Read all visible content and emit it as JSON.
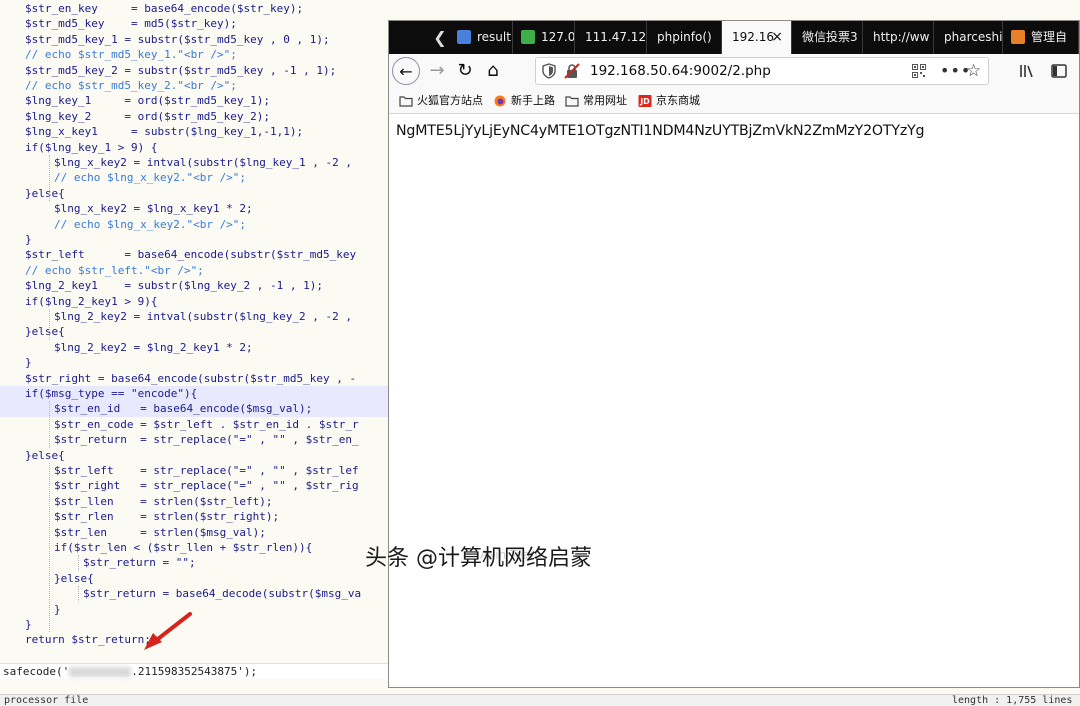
{
  "editor": {
    "code_lines": [
      {
        "indent": 1,
        "text": "$str_en_key     = base64_encode($str_key);"
      },
      {
        "indent": 1,
        "text": "$str_md5_key    = md5($str_key);"
      },
      {
        "indent": 1,
        "text": "$str_md5_key_1 = substr($str_md5_key , 0 , 1);"
      },
      {
        "indent": 1,
        "text": "// echo $str_md5_key_1.\"<br />\";",
        "comment": true
      },
      {
        "indent": 1,
        "text": "$str_md5_key_2 = substr($str_md5_key , -1 , 1);"
      },
      {
        "indent": 1,
        "text": "// echo $str_md5_key_2.\"<br />\";",
        "comment": true
      },
      {
        "indent": 1,
        "text": "$lng_key_1     = ord($str_md5_key_1);"
      },
      {
        "indent": 1,
        "text": "$lng_key_2     = ord($str_md5_key_2);"
      },
      {
        "indent": 1,
        "text": "$lng_x_key1     = substr($lng_key_1,-1,1);"
      },
      {
        "indent": 1,
        "text": "if($lng_key_1 > 9) {"
      },
      {
        "indent": 2,
        "text": "$lng_x_key2 = intval(substr($lng_key_1 , -2 ,"
      },
      {
        "indent": 2,
        "text": "// echo $lng_x_key2.\"<br />\";",
        "comment": true
      },
      {
        "indent": 1,
        "text": "}else{"
      },
      {
        "indent": 2,
        "text": "$lng_x_key2 = $lng_x_key1 * 2;"
      },
      {
        "indent": 2,
        "text": "// echo $lng_x_key2.\"<br />\";",
        "comment": true
      },
      {
        "indent": 1,
        "text": "}"
      },
      {
        "indent": 1,
        "text": "$str_left      = base64_encode(substr($str_md5_key"
      },
      {
        "indent": 1,
        "text": "// echo $str_left.\"<br />\";",
        "comment": true
      },
      {
        "indent": 1,
        "text": "$lng_2_key1    = substr($lng_key_2 , -1 , 1);"
      },
      {
        "indent": 1,
        "text": "if($lng_2_key1 > 9){"
      },
      {
        "indent": 2,
        "text": "$lng_2_key2 = intval(substr($lng_key_2 , -2 ,"
      },
      {
        "indent": 1,
        "text": "}else{"
      },
      {
        "indent": 2,
        "text": "$lng_2_key2 = $lng_2_key1 * 2;"
      },
      {
        "indent": 1,
        "text": "}"
      },
      {
        "indent": 1,
        "text": "$str_right = base64_encode(substr($str_md5_key , -"
      },
      {
        "indent": 1,
        "text": "if($msg_type == \"encode\"){",
        "highlight": true
      },
      {
        "indent": 2,
        "text": "$str_en_id   = base64_encode($msg_val);",
        "highlight": true
      },
      {
        "indent": 2,
        "text": "$str_en_code = $str_left . $str_en_id . $str_r"
      },
      {
        "indent": 2,
        "text": "$str_return  = str_replace(\"=\" , \"\" , $str_en_"
      },
      {
        "indent": 1,
        "text": "}else{"
      },
      {
        "indent": 2,
        "text": "$str_left    = str_replace(\"=\" , \"\" , $str_lef"
      },
      {
        "indent": 2,
        "text": "$str_right   = str_replace(\"=\" , \"\" , $str_rig"
      },
      {
        "indent": 2,
        "text": "$str_llen    = strlen($str_left);"
      },
      {
        "indent": 2,
        "text": "$str_rlen    = strlen($str_right);"
      },
      {
        "indent": 2,
        "text": "$str_len     = strlen($msg_val);"
      },
      {
        "indent": 2,
        "text": "if($str_len < ($str_llen + $str_rlen)){"
      },
      {
        "indent": 3,
        "text": "$str_return = \"\";"
      },
      {
        "indent": 2,
        "text": "}else{"
      },
      {
        "indent": 3,
        "text": "$str_return = base64_decode(substr($msg_va"
      },
      {
        "indent": 2,
        "text": "}"
      },
      {
        "indent": 1,
        "text": "}"
      },
      {
        "indent": 1,
        "text": "return $str_return;"
      }
    ],
    "last_line_prefix": "safecode('",
    "last_line_suffix": ".211598352543875');",
    "status_left": "processor file",
    "status_right": "length : 1,755    lines"
  },
  "browser": {
    "tabs": [
      {
        "label": "result",
        "icon": "paw-icon",
        "color": "#4a7fdc"
      },
      {
        "label": "127.0",
        "icon": "leaf-icon",
        "color": "#3fae49"
      },
      {
        "label": "111.47.12",
        "icon": "",
        "color": ""
      },
      {
        "label": "phpinfo()",
        "icon": "",
        "color": ""
      },
      {
        "label": "192.16",
        "icon": "",
        "color": "",
        "active": true
      },
      {
        "label": "微信投票3",
        "icon": "",
        "color": ""
      },
      {
        "label": "http://ww",
        "icon": "",
        "color": ""
      },
      {
        "label": "pharceshi",
        "icon": "",
        "color": ""
      },
      {
        "label": "管理自",
        "icon": "box-icon",
        "color": "#e8802a"
      }
    ],
    "tab_close_glyph": "×",
    "tab_scroll_glyph": "❮",
    "nav": {
      "back_glyph": "←",
      "forward_glyph": "→",
      "reload_glyph": "↻",
      "home_glyph": "⌂"
    },
    "url": "192.168.50.64:9002/2.php",
    "url_more_glyph": "•••",
    "url_star_glyph": "☆",
    "bookmarks": [
      {
        "label": "火狐官方站点",
        "icon": "folder-icon"
      },
      {
        "label": "新手上路",
        "icon": "firefox-icon"
      },
      {
        "label": "常用网址",
        "icon": "folder-icon"
      },
      {
        "label": "京东商城",
        "icon": "jd-icon"
      }
    ],
    "jd_icon_text": "JD",
    "page_content": "NgMTE5LjYyLjEyNC4yMTE1OTgzNTI1NDM4NzUYTBjZmVkN2ZmMzY2OTYzYg"
  },
  "watermark": "头条 @计算机网络启蒙",
  "watermark_faint": "Axin Team",
  "colors": {
    "accent_red": "#d8231d",
    "code_blue": "#1a1a8c",
    "comment_blue": "#3a7ad8"
  }
}
